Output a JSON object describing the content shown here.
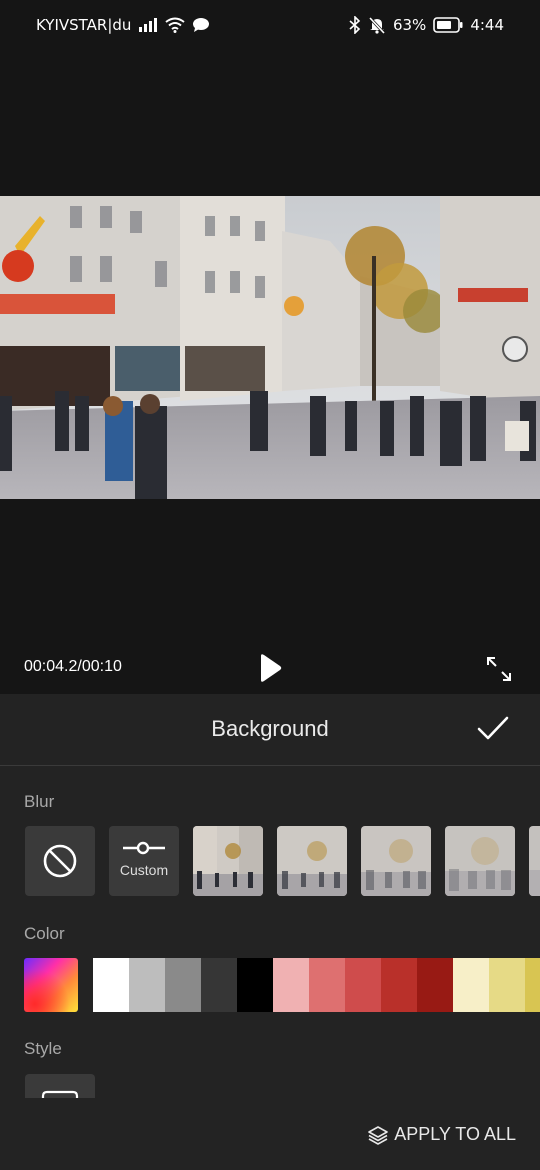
{
  "status_bar": {
    "carrier": "KYIVSTAR|du",
    "battery": "63%",
    "time": "4:44",
    "icons": [
      "signal-icon",
      "wifi-icon",
      "message-icon",
      "bluetooth-icon",
      "mute-icon",
      "battery-icon"
    ]
  },
  "player": {
    "time": "00:04.2/00:10",
    "play_icon": "play-icon",
    "fullscreen_icon": "fullscreen-icon"
  },
  "panel": {
    "title": "Background",
    "confirm_icon": "checkmark-icon",
    "blur": {
      "label": "Blur",
      "none_icon": "no-blur-icon",
      "custom_label": "Custom",
      "custom_icon": "slider-icon"
    },
    "color": {
      "label": "Color",
      "swatches": [
        "#ffffff",
        "#bdbdbd",
        "#8a8a8a",
        "#363636",
        "#000000",
        "#f0b1b2",
        "#de7070",
        "#cf4c4c",
        "#b9302a",
        "#981a14",
        "#f7efc8",
        "#e6da86",
        "#d8c552"
      ]
    },
    "style": {
      "label": "Style"
    },
    "apply_all": "APPLY TO ALL",
    "apply_icon": "layers-icon"
  },
  "colors": {
    "background": "#151515",
    "panel": "#232323",
    "tile": "#3a3a3a",
    "muted_text": "#a8a8a8"
  }
}
